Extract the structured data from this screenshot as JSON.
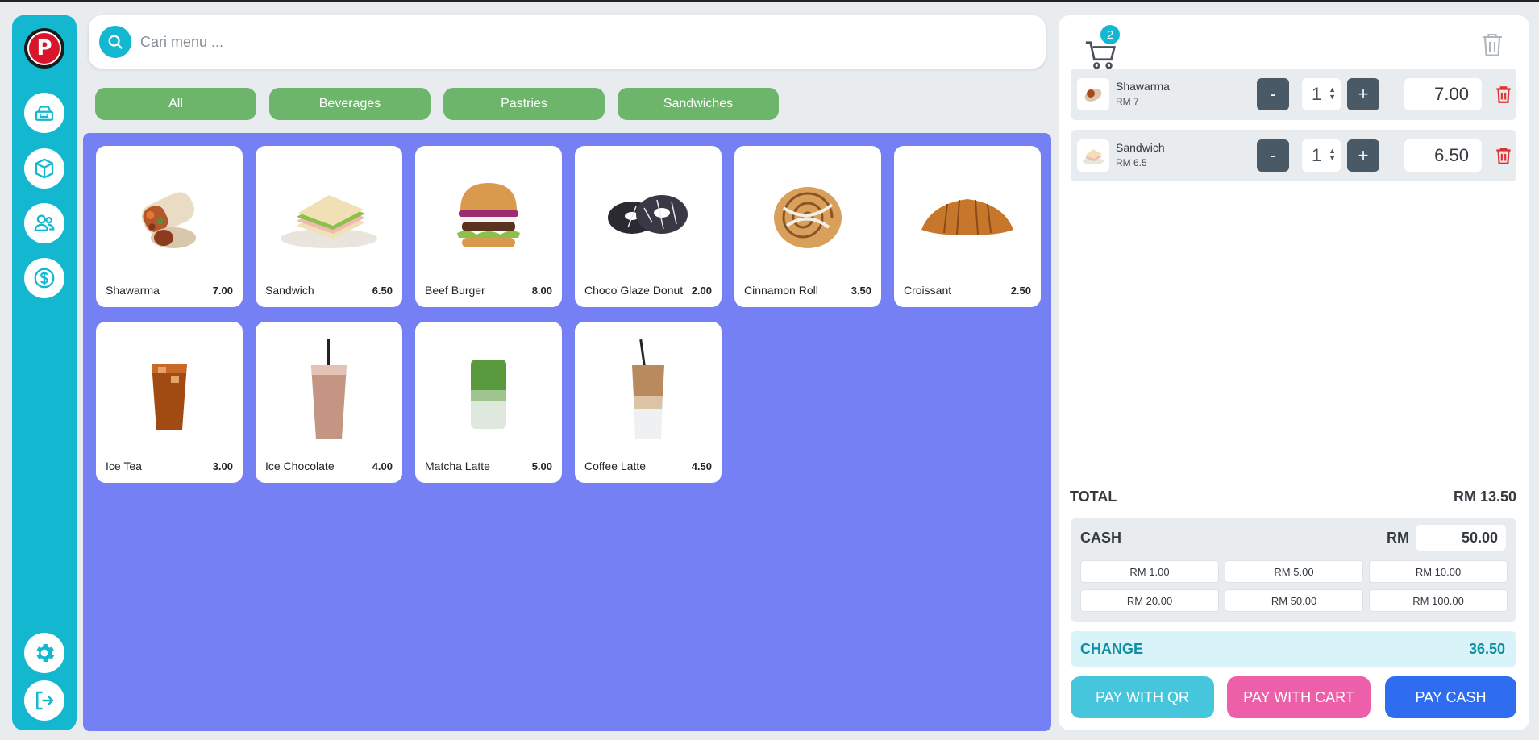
{
  "search": {
    "placeholder": "Cari menu ..."
  },
  "categories": [
    "All",
    "Beverages",
    "Pastries",
    "Sandwiches"
  ],
  "menu": [
    {
      "name": "Shawarma",
      "price": "7.00",
      "icon": "shawarma-image"
    },
    {
      "name": "Sandwich",
      "price": "6.50",
      "icon": "sandwich-image"
    },
    {
      "name": "Beef Burger",
      "price": "8.00",
      "icon": "burger-image"
    },
    {
      "name": "Choco Glaze Donut",
      "price": "2.00",
      "icon": "donut-image"
    },
    {
      "name": "Cinnamon Roll",
      "price": "3.50",
      "icon": "cinnamon-roll-image"
    },
    {
      "name": "Croissant",
      "price": "2.50",
      "icon": "croissant-image"
    },
    {
      "name": "Ice Tea",
      "price": "3.00",
      "icon": "ice-tea-image"
    },
    {
      "name": "Ice Chocolate",
      "price": "4.00",
      "icon": "ice-chocolate-image"
    },
    {
      "name": "Matcha Latte",
      "price": "5.00",
      "icon": "matcha-latte-image"
    },
    {
      "name": "Coffee Latte",
      "price": "4.50",
      "icon": "coffee-latte-image"
    }
  ],
  "cart": {
    "count": "2",
    "items": [
      {
        "name": "Shawarma",
        "unit": "RM 7",
        "minus": "-",
        "qty": "1",
        "plus": "+",
        "total": "7.00"
      },
      {
        "name": "Sandwich",
        "unit": "RM 6.5",
        "minus": "-",
        "qty": "1",
        "plus": "+",
        "total": "6.50"
      }
    ],
    "total_label": "TOTAL",
    "total_value": "RM 13.50",
    "cash_label": "CASH",
    "cash_currency": "RM",
    "cash_value": "50.00",
    "quick_amounts": [
      "RM 1.00",
      "RM 5.00",
      "RM 10.00",
      "RM 20.00",
      "RM 50.00",
      "RM 100.00"
    ],
    "change_label": "CHANGE",
    "change_value": "36.50"
  },
  "actions": {
    "pay_qr": "PAY WITH QR",
    "pay_card": "PAY WITH CART",
    "pay_cash": "PAY CASH"
  },
  "sidebar": {
    "logo_letter": "P",
    "icons": [
      "cash-register-icon",
      "box-icon",
      "users-icon",
      "dollar-icon",
      "gear-icon",
      "logout-icon"
    ]
  },
  "colors": {
    "sidebar": "#13b8d0",
    "category": "#6cb56a",
    "menu_bg": "#7680f5",
    "pay_qr": "#45c6dc",
    "pay_card": "#ee5fa9",
    "pay_cash": "#2f6df0",
    "danger": "#e03131"
  }
}
